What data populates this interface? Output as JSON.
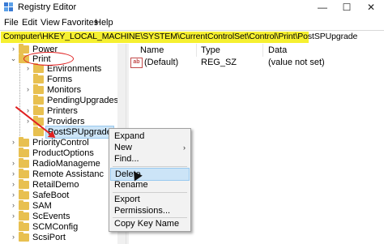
{
  "window": {
    "title": "Registry Editor",
    "minimize": "—",
    "maximize": "☐",
    "close": "✕"
  },
  "menu": [
    "File",
    "Edit",
    "View",
    "Favorites",
    "Help"
  ],
  "address": "Computer\\HKEY_LOCAL_MACHINE\\SYSTEM\\CurrentControlSet\\Control\\Print\\PostSPUpgrade",
  "tree": {
    "power": "Power",
    "print": "Print",
    "print_children": [
      "Environments",
      "Forms",
      "Monitors",
      "PendingUpgrades",
      "Printers",
      "Providers",
      "PostSPUpgrade"
    ],
    "siblings": [
      "PriorityControl",
      "ProductOptions",
      "RadioManageme",
      "Remote Assistanc",
      "RetailDemo",
      "SafeBoot",
      "SAM",
      "ScEvents",
      "SCMConfig",
      "ScsiPort"
    ]
  },
  "table": {
    "headers": [
      "Name",
      "Type",
      "Data"
    ],
    "rows": [
      {
        "name": "(Default)",
        "type": "REG_SZ",
        "data": "(value not set)"
      }
    ]
  },
  "context_menu": {
    "items": [
      "Expand",
      "New",
      "Find...",
      "Delete",
      "Rename",
      "Export",
      "Permissions...",
      "Copy Key Name"
    ],
    "highlighted": "Delete"
  },
  "colors": {
    "address_highlight": "#f6f030",
    "annotation": "#e02020",
    "selection": "#cce4f7"
  }
}
